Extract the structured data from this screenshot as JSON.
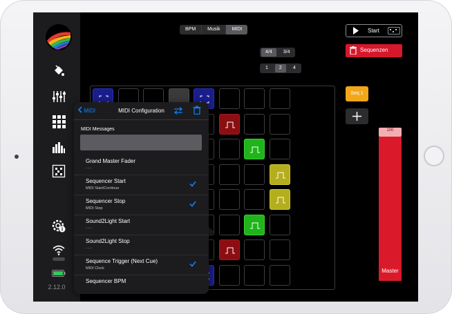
{
  "app": {
    "version": "2.12.0"
  },
  "sidebar": {
    "icons": [
      "paint-bucket-icon",
      "sliders-icon",
      "grid-icon",
      "equalizer-icon",
      "matrix-icon",
      "gear-info-icon",
      "wifi-icon",
      "battery-icon"
    ]
  },
  "top_tabs": [
    {
      "label": "BPM",
      "selected": false
    },
    {
      "label": "Musik",
      "selected": false
    },
    {
      "label": "MIDI",
      "selected": true
    }
  ],
  "time_signature": [
    {
      "label": "4/4",
      "selected": true
    },
    {
      "label": "3/4",
      "selected": false
    }
  ],
  "bars": [
    {
      "label": "1",
      "selected": false
    },
    {
      "label": "2",
      "selected": true
    },
    {
      "label": "4",
      "selected": false
    }
  ],
  "transport": {
    "start_label": "Start"
  },
  "sequences": {
    "button_label": "Sequenzen",
    "current": "Seq 1"
  },
  "fader": {
    "value_label": "100",
    "level": 1.0,
    "name": "Master"
  },
  "midi_panel": {
    "back_label": "MIDI",
    "title": "MIDI Configuration",
    "section_label": "MIDI Messages",
    "search_value": "",
    "items": [
      {
        "title": "Grand Master Fader",
        "subtitle": "- - -",
        "checked": false
      },
      {
        "title": "Sequencer Start",
        "subtitle": "MIDI Start/Continue",
        "checked": true
      },
      {
        "title": "Sequencer Stop",
        "subtitle": "MIDI Stop",
        "checked": true
      },
      {
        "title": "Sound2Light Start",
        "subtitle": "- - -",
        "checked": false
      },
      {
        "title": "Sound2Light Stop",
        "subtitle": "- - -",
        "checked": false
      },
      {
        "title": "Sequence Trigger (Next Cue)",
        "subtitle": "MIDI Clock",
        "checked": true
      },
      {
        "title": "Sequencer BPM",
        "subtitle": "",
        "checked": false
      }
    ]
  },
  "step_grid": {
    "rows": 8,
    "cols": 8,
    "active": [
      {
        "row": 0,
        "col": 0,
        "color": "blue"
      },
      {
        "row": 0,
        "col": 3,
        "color": "gray"
      },
      {
        "row": 0,
        "col": 4,
        "color": "blue"
      },
      {
        "row": 1,
        "col": 5,
        "color": "red"
      },
      {
        "row": 2,
        "col": 6,
        "color": "green"
      },
      {
        "row": 3,
        "col": 7,
        "color": "yellow"
      },
      {
        "row": 4,
        "col": 7,
        "color": "yellow"
      },
      {
        "row": 5,
        "col": 6,
        "color": "green"
      },
      {
        "row": 6,
        "col": 5,
        "color": "red"
      },
      {
        "row": 7,
        "col": 4,
        "color": "blue"
      }
    ]
  }
}
